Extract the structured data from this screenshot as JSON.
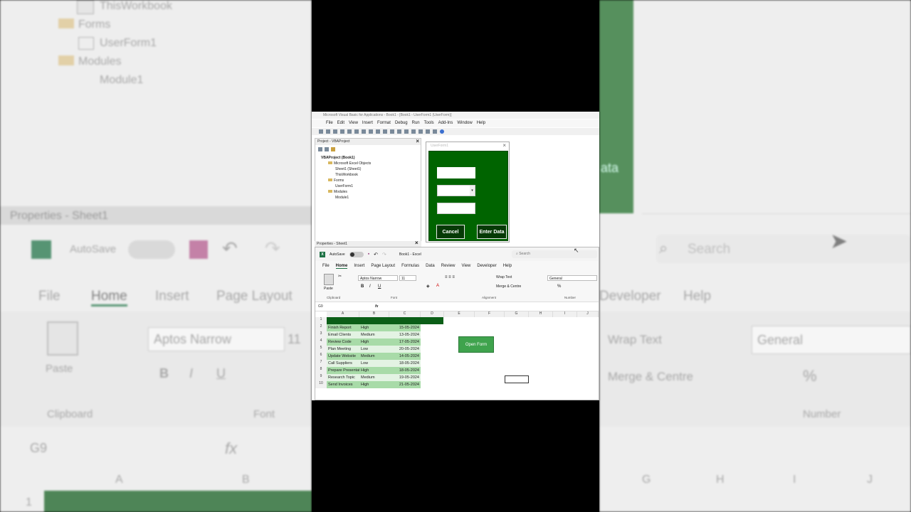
{
  "background_left": {
    "tree": [
      "ThisWorkbook",
      "Forms",
      "UserForm1",
      "Modules",
      "Module1"
    ],
    "properties_title": "Properties - Sheet1",
    "autosave": "AutoSave",
    "tabs": [
      "File",
      "Home",
      "Insert",
      "Page Layout"
    ],
    "font_name": "Aptos Narrow",
    "font_size": "11",
    "paste": "Paste",
    "clipboard": "Clipboard",
    "font_group": "Font",
    "name_box": "G9",
    "fx": "fx",
    "col_a": "A",
    "col_b": "B",
    "row_1": "1"
  },
  "background_right": {
    "search": "Search",
    "tabs": [
      "Developer",
      "Help"
    ],
    "wrap_text": "Wrap Text",
    "merge_centre": "Merge & Centre",
    "number_format": "General",
    "number_group": "Number",
    "cols": [
      "G",
      "H",
      "I",
      "J"
    ],
    "ata": "ata"
  },
  "vba": {
    "title": "Microsoft Visual Basic for Applications - Book1 - [Book1 - UserForm1 (UserForm)]",
    "menu": [
      "File",
      "Edit",
      "View",
      "Insert",
      "Format",
      "Debug",
      "Run",
      "Tools",
      "Add-Ins",
      "Window",
      "Help"
    ],
    "project_title": "Project - VBAProject",
    "tree": {
      "root": "VBAProject (Book1)",
      "excel_objects": "Microsoft Excel Objects",
      "sheet1": "Sheet1 (Sheet1)",
      "thisworkbook": "ThisWorkbook",
      "forms": "Forms",
      "userform1": "UserForm1",
      "modules": "Modules",
      "module1": "Module1"
    },
    "form_caption": "UserForm1",
    "cancel": "Cancel",
    "enter_data": "Enter Data",
    "properties_title": "Properties - Sheet1"
  },
  "excel": {
    "autosave": "AutoSave",
    "book_title": "Book1 - Excel",
    "search": "Search",
    "tabs": [
      "File",
      "Home",
      "Insert",
      "Page Layout",
      "Formulas",
      "Data",
      "Review",
      "View",
      "Developer",
      "Help"
    ],
    "active_tab": "Home",
    "paste": "Paste",
    "font_name": "Aptos Narrow",
    "font_size": "11",
    "wrap_text": "Wrap Text",
    "merge_centre": "Merge & Centre",
    "number_format": "General",
    "groups": [
      "Clipboard",
      "Font",
      "Alignment",
      "Number"
    ],
    "name_box": "G9",
    "fx": "fx",
    "columns": [
      "A",
      "B",
      "C",
      "D",
      "E",
      "F",
      "G",
      "H",
      "I",
      "J"
    ],
    "rows": [
      {
        "num": "2",
        "task": "Finish Report",
        "priority": "High",
        "date": "15-05-2024"
      },
      {
        "num": "3",
        "task": "Email Clients",
        "priority": "Medium",
        "date": "13-05-2024"
      },
      {
        "num": "4",
        "task": "Review Code",
        "priority": "High",
        "date": "17-05-2024"
      },
      {
        "num": "5",
        "task": "Plan Meeting",
        "priority": "Low",
        "date": "20-05-2024"
      },
      {
        "num": "6",
        "task": "Update Website",
        "priority": "Medium",
        "date": "14-05-2024"
      },
      {
        "num": "7",
        "task": "Call Suppliers",
        "priority": "Low",
        "date": "18-05-2024"
      },
      {
        "num": "8",
        "task": "Prepare Presentation",
        "priority": "High",
        "date": "18-05-2024"
      },
      {
        "num": "9",
        "task": "Research Topic",
        "priority": "Medium",
        "date": "19-05-2024"
      },
      {
        "num": "10",
        "task": "Send Invoices",
        "priority": "High",
        "date": "21-05-2024"
      }
    ],
    "row1": "1",
    "open_form": "Open Form"
  }
}
